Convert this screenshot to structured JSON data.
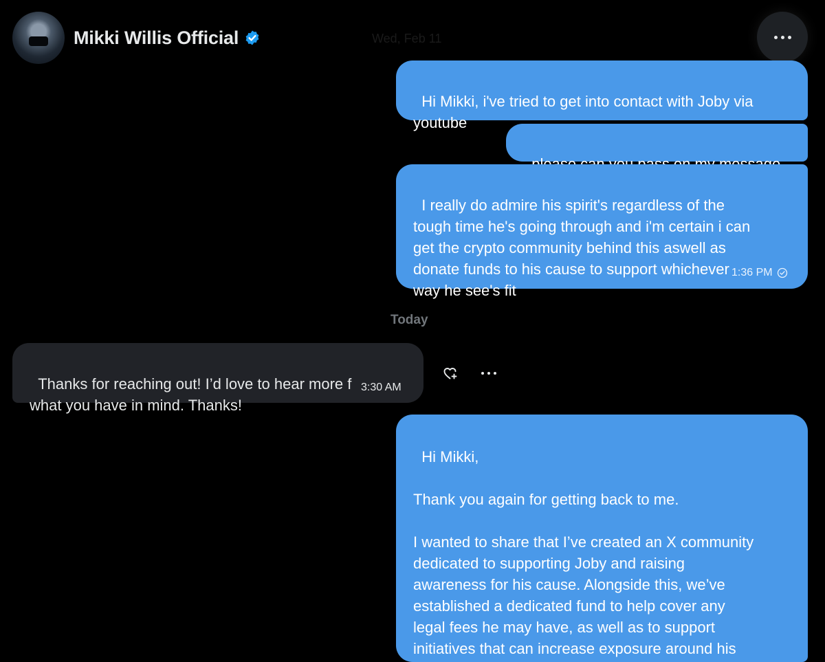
{
  "header": {
    "name": "Mikki Willis Official",
    "verified": true,
    "avatar_icon": "avatar"
  },
  "separators": {
    "top_date": "Wed, Feb 11",
    "today": "Today"
  },
  "messages": [
    {
      "direction": "out",
      "text": "Hi Mikki, i've tried to get into contact with Joby via\nyoutube"
    },
    {
      "direction": "out",
      "text": "please can you pass on my message"
    },
    {
      "direction": "out",
      "text": "I really do admire his spirit's regardless of the\ntough time he's going through and i'm certain i can\nget the crypto community behind this aswell as\ndonate funds to his cause to support whichever\nway he see's fit",
      "time": "1:36 PM",
      "status_icon": "check-circle-icon"
    },
    {
      "direction": "in",
      "text": "Thanks for reaching out! I’d love to hear more f\nwhat you have in mind. Thanks!",
      "time": "3:30 AM"
    },
    {
      "direction": "out",
      "text": "Hi Mikki,\n\nThank you again for getting back to me.\n\nI wanted to share that I’ve created an X community\ndedicated to supporting Joby and raising\nawareness for his cause. Alongside this, we’ve\nestablished a dedicated fund to help cover any\nlegal fees he may have, as well as to support\ninitiatives that can increase exposure around his"
    }
  ],
  "colors": {
    "outgoing_bubble": "#4a99e9",
    "incoming_bubble": "#212328",
    "background": "#000000",
    "verified_badge": "#1d9bf0"
  }
}
